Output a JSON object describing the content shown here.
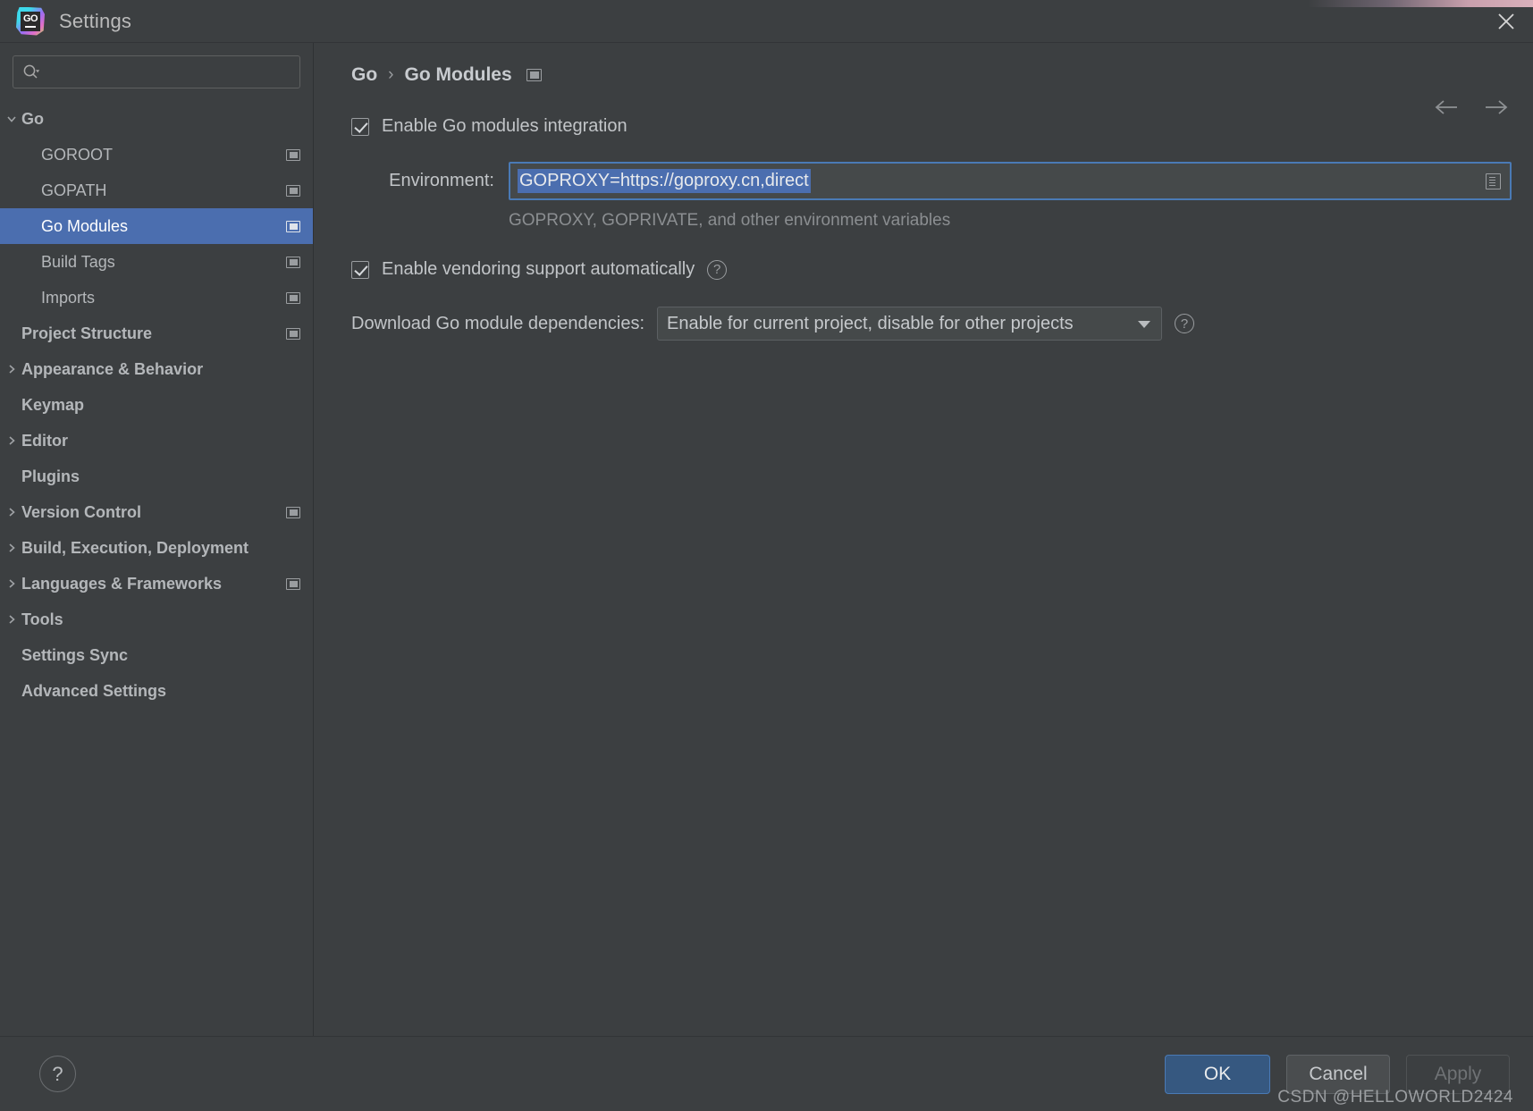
{
  "window": {
    "title": "Settings",
    "app_icon": "goland-icon",
    "icon_text": "GO",
    "close_icon": "close-icon"
  },
  "search": {
    "value": "",
    "placeholder": "",
    "icon": "search-icon"
  },
  "sidebar": {
    "items": [
      {
        "label": "Go",
        "level": 0,
        "bold": true,
        "expanded": true,
        "chevron": "chevron-down-icon",
        "scope_icon": false,
        "selected": false
      },
      {
        "label": "GOROOT",
        "level": 1,
        "bold": false,
        "chevron": "",
        "scope_icon": true,
        "selected": false
      },
      {
        "label": "GOPATH",
        "level": 1,
        "bold": false,
        "chevron": "",
        "scope_icon": true,
        "selected": false
      },
      {
        "label": "Go Modules",
        "level": 1,
        "bold": false,
        "chevron": "",
        "scope_icon": true,
        "selected": true
      },
      {
        "label": "Build Tags",
        "level": 1,
        "bold": false,
        "chevron": "",
        "scope_icon": true,
        "selected": false
      },
      {
        "label": "Imports",
        "level": 1,
        "bold": false,
        "chevron": "",
        "scope_icon": true,
        "selected": false
      },
      {
        "label": "Project Structure",
        "level": 0,
        "bold": true,
        "chevron": "",
        "scope_icon": true,
        "selected": false
      },
      {
        "label": "Appearance & Behavior",
        "level": 0,
        "bold": true,
        "chevron": "chevron-right-icon",
        "scope_icon": false,
        "selected": false
      },
      {
        "label": "Keymap",
        "level": 0,
        "bold": true,
        "chevron": "",
        "scope_icon": false,
        "selected": false
      },
      {
        "label": "Editor",
        "level": 0,
        "bold": true,
        "chevron": "chevron-right-icon",
        "scope_icon": false,
        "selected": false
      },
      {
        "label": "Plugins",
        "level": 0,
        "bold": true,
        "chevron": "",
        "scope_icon": false,
        "selected": false
      },
      {
        "label": "Version Control",
        "level": 0,
        "bold": true,
        "chevron": "chevron-right-icon",
        "scope_icon": true,
        "selected": false
      },
      {
        "label": "Build, Execution, Deployment",
        "level": 0,
        "bold": true,
        "chevron": "chevron-right-icon",
        "scope_icon": false,
        "selected": false
      },
      {
        "label": "Languages & Frameworks",
        "level": 0,
        "bold": true,
        "chevron": "chevron-right-icon",
        "scope_icon": true,
        "selected": false
      },
      {
        "label": "Tools",
        "level": 0,
        "bold": true,
        "chevron": "chevron-right-icon",
        "scope_icon": false,
        "selected": false
      },
      {
        "label": "Settings Sync",
        "level": 0,
        "bold": true,
        "chevron": "",
        "scope_icon": false,
        "selected": false
      },
      {
        "label": "Advanced Settings",
        "level": 0,
        "bold": true,
        "chevron": "",
        "scope_icon": false,
        "selected": false
      }
    ]
  },
  "breadcrumb": {
    "parent": "Go",
    "separator": "›",
    "current": "Go Modules",
    "scope_icon": "project-scope-icon"
  },
  "navigation": {
    "back_icon": "arrow-left-icon",
    "forward_icon": "arrow-right-icon"
  },
  "main": {
    "enable_modules": {
      "label": "Enable Go modules integration",
      "checked": true
    },
    "environment": {
      "label": "Environment:",
      "value": "GOPROXY=https://goproxy.cn,direct",
      "selected": true,
      "expand_icon": "expand-editor-icon",
      "hint": "GOPROXY, GOPRIVATE, and other environment variables"
    },
    "vendoring": {
      "label": "Enable vendoring support automatically",
      "checked": true,
      "help_icon": "help-circle-icon",
      "help_glyph": "?"
    },
    "download": {
      "label": "Download Go module dependencies:",
      "value": "Enable for current project, disable for other projects",
      "dropdown_icon": "chevron-down-icon",
      "help_icon": "help-circle-icon",
      "help_glyph": "?"
    }
  },
  "footer": {
    "help_icon": "help-circle-icon",
    "help_glyph": "?",
    "ok_label": "OK",
    "cancel_label": "Cancel",
    "apply_label": "Apply",
    "apply_disabled": true,
    "watermark": "CSDN @HELLOWORLD2424"
  },
  "colors": {
    "background": "#3c3f41",
    "selection": "#4b6eaf",
    "focus_border": "#4a7ab5",
    "primary_button": "#365880",
    "text": "#c2c5c8",
    "muted_text": "#8b8e91"
  }
}
